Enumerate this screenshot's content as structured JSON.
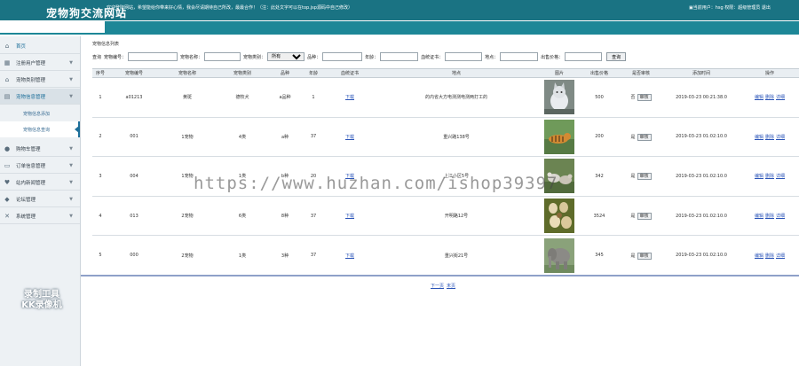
{
  "header": {
    "title": "宠物狗交流网站",
    "notice": "欢迎登陆网站，希望能给你带来好心情，我会尽请期待自己所改，最最合作！（注：此处文字可以在top.jsp源码中自己修改）",
    "user_prefix": "当前用户：",
    "username": "hsg",
    "role": "权限：超级管理员",
    "logout": "退出"
  },
  "sidebar": {
    "items": [
      {
        "label": "首页",
        "icon": "home-icon"
      },
      {
        "label": "注册用户管理",
        "icon": "users-icon"
      },
      {
        "label": "宠物类别管理",
        "icon": "category-icon"
      },
      {
        "label": "宠物信息管理",
        "icon": "pet-icon"
      },
      {
        "label": "宠物信息添加"
      },
      {
        "label": "宠物信息查询"
      },
      {
        "label": "购物车管理",
        "icon": "cart-icon"
      },
      {
        "label": "订单信息管理",
        "icon": "order-icon"
      },
      {
        "label": "站内新闻管理",
        "icon": "news-icon"
      },
      {
        "label": "论坛管理",
        "icon": "forum-icon"
      },
      {
        "label": "系统管理",
        "icon": "tools-icon"
      }
    ],
    "badge_line1": "录制工具",
    "badge_line2": "KK录像机"
  },
  "main": {
    "caption": "宠物信息列表",
    "search": {
      "prefix": "查询",
      "id_label": "宠物编号：",
      "name_label": "宠物名称：",
      "category_label": "宠物类别：",
      "category_value": "所有",
      "breed_label": "品种：",
      "age_label": "年龄：",
      "cert_label": "血统证书：",
      "location_label": "地点：",
      "price_label": "出售价格：",
      "button": "查询"
    },
    "columns": [
      "序号",
      "宠物编号",
      "宠物名称",
      "宠物类别",
      "品种",
      "年龄",
      "血统证书",
      "地点",
      "图片",
      "出售价格",
      "是否审核",
      "添加时间",
      "操作"
    ],
    "rows": [
      {
        "no": "1",
        "id": "a01213",
        "name": "黄斑",
        "category": "德牧犬",
        "breed": "a品种",
        "age": "1",
        "cert": "下载",
        "location": "的内省大方电测测电测两打工的",
        "price": "500",
        "audited": "否",
        "audit_btn": "审核",
        "time": "2019-03-23 00:21:38.0",
        "image": "cat"
      },
      {
        "no": "2",
        "id": "001",
        "name": "1宠物",
        "category": "4类",
        "breed": "a种",
        "age": "37",
        "cert": "下载",
        "location": "重兴路138号",
        "price": "200",
        "audited": "是",
        "audit_btn": "审核",
        "time": "2019-03-23 01:02:10.0",
        "image": "tiger"
      },
      {
        "no": "3",
        "id": "004",
        "name": "1宠物",
        "category": "1类",
        "breed": "b种",
        "age": "20",
        "cert": "下载",
        "location": "上江小区5号",
        "price": "342",
        "audited": "是",
        "audit_btn": "审核",
        "time": "2019-03-23 01:02:10.0",
        "image": "goats"
      },
      {
        "no": "4",
        "id": "013",
        "name": "2宠物",
        "category": "6类",
        "breed": "8种",
        "age": "37",
        "cert": "下载",
        "location": "开明路12号",
        "price": "3524",
        "audited": "是",
        "audit_btn": "审核",
        "time": "2019-03-23 01:02:10.0",
        "image": "shells"
      },
      {
        "no": "5",
        "id": "000",
        "name": "2宠物",
        "category": "1类",
        "breed": "3种",
        "age": "37",
        "cert": "下载",
        "location": "重兴街21号",
        "price": "345",
        "audited": "是",
        "audit_btn": "审核",
        "time": "2019-03-23 01:02:10.0",
        "image": "elephant"
      }
    ],
    "ops": {
      "edit": "编辑",
      "delete": "删除",
      "detail": "详细"
    },
    "pager": {
      "next": "下一页",
      "last": "末页"
    }
  },
  "watermark": "https://www.huzhan.com/ishop39397",
  "colors": {
    "header": "#1a7383",
    "notice_band": "#1d8797",
    "link": "#2a54b8"
  }
}
